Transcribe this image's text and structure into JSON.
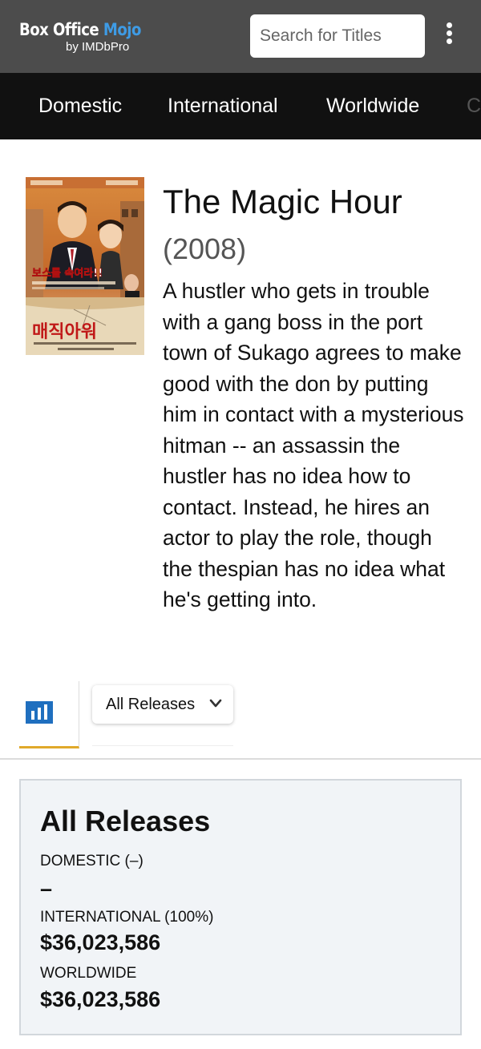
{
  "header": {
    "logo_box_office": "Box Office ",
    "logo_mojo": "Mojo",
    "logo_by": "by IMDbPro",
    "search_placeholder": "Search for Titles"
  },
  "nav": {
    "items": [
      "Domestic",
      "International",
      "Worldwide",
      "C"
    ]
  },
  "movie": {
    "title": "The Magic Hour",
    "year": "(2008)",
    "description": "A hustler who gets in trouble with a gang boss in the port town of Sukago agrees to make good with the don by putting him in contact with a mysterious hitman -- an assassin the hustler has no idea how to contact. Instead, he hires an actor to play the role, though the thespian has no idea what he's getting into.",
    "poster": {
      "headline_kr": "보스를 속여라!!",
      "title_kr": "매직아워"
    }
  },
  "release_select": {
    "selected": "All Releases"
  },
  "summary": {
    "heading": "All Releases",
    "domestic_label": "DOMESTIC (–)",
    "domestic_value": "–",
    "international_label": "INTERNATIONAL (100%)",
    "international_value": "$36,023,586",
    "worldwide_label": "WORLDWIDE",
    "worldwide_value": "$36,023,586"
  },
  "colors": {
    "header_bg": "#4c4c4c",
    "nav_bg": "#111111",
    "mojo_blue": "#3e9be5",
    "tab_accent": "#e0a92b",
    "chart_icon_blue": "#1f6fbf",
    "card_bg": "#f1f4f7"
  },
  "icons": {
    "menu": "kebab-menu-icon",
    "tab": "bar-chart-icon",
    "dropdown": "chevron-down-icon"
  }
}
